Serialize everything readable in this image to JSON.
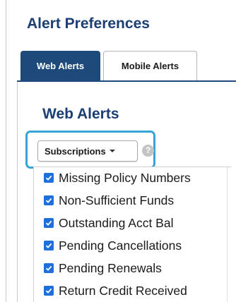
{
  "page": {
    "title": "Alert Preferences"
  },
  "tabs": [
    {
      "label": "Web Alerts",
      "active": true
    },
    {
      "label": "Mobile Alerts",
      "active": false
    }
  ],
  "section": {
    "title": "Web Alerts"
  },
  "dropdown": {
    "label": "Subscriptions",
    "help_icon": "?"
  },
  "menu": {
    "items": [
      {
        "label": "Missing Policy Numbers",
        "checked": true
      },
      {
        "label": "Non-Sufficient Funds",
        "checked": true
      },
      {
        "label": "Outstanding Acct Bal",
        "checked": true
      },
      {
        "label": "Pending Cancellations",
        "checked": true
      },
      {
        "label": "Pending Renewals",
        "checked": true
      },
      {
        "label": "Return Credit Received",
        "checked": true
      }
    ]
  },
  "colors": {
    "accent": "#1e4a7b",
    "title": "#1b3f73",
    "checkbox": "#1e6fd9",
    "focus_ring": "#37a4d6"
  }
}
